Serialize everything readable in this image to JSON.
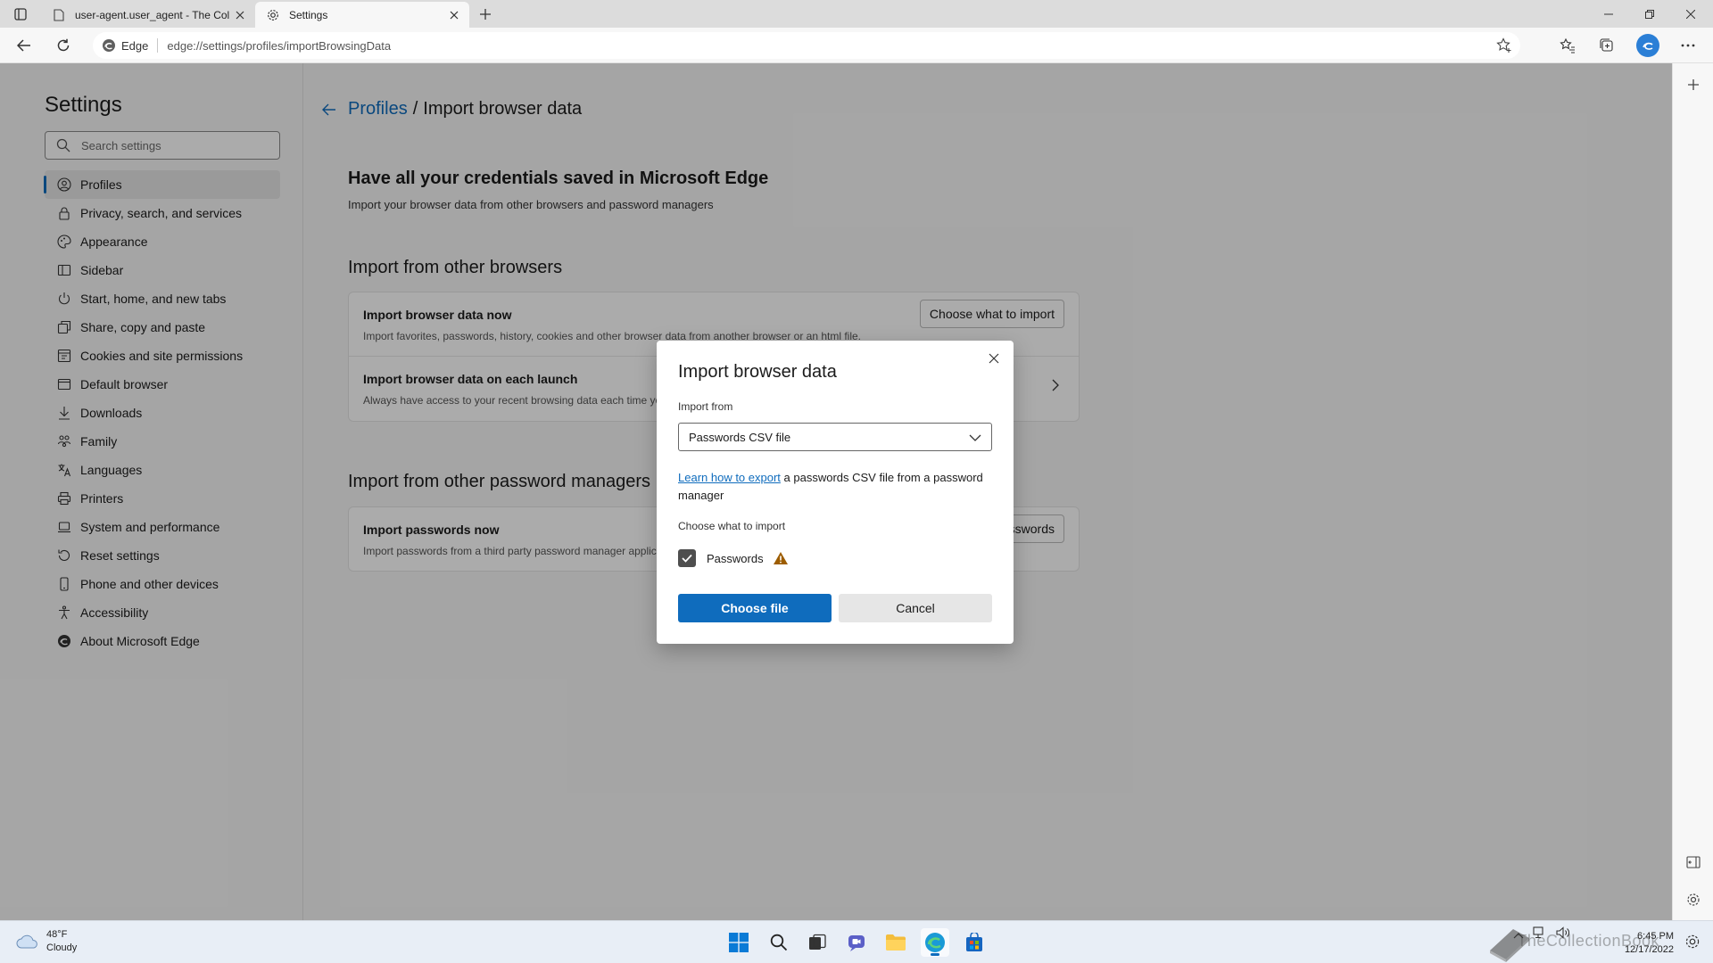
{
  "browser": {
    "tabs": [
      {
        "title": "user-agent.user_agent - The Coll",
        "active": false
      },
      {
        "title": "Settings",
        "active": true
      }
    ],
    "address": {
      "badge": "Edge",
      "url": "edge://settings/profiles/importBrowsingData"
    }
  },
  "sidebar": {
    "title": "Settings",
    "search_placeholder": "Search settings",
    "items": [
      {
        "label": "Profiles",
        "icon": "person-icon"
      },
      {
        "label": "Privacy, search, and services",
        "icon": "lock-icon"
      },
      {
        "label": "Appearance",
        "icon": "palette-icon"
      },
      {
        "label": "Sidebar",
        "icon": "sidebar-icon"
      },
      {
        "label": "Start, home, and new tabs",
        "icon": "power-icon"
      },
      {
        "label": "Share, copy and paste",
        "icon": "share-icon"
      },
      {
        "label": "Cookies and site permissions",
        "icon": "cookie-icon"
      },
      {
        "label": "Default browser",
        "icon": "browser-icon"
      },
      {
        "label": "Downloads",
        "icon": "download-icon"
      },
      {
        "label": "Family",
        "icon": "family-icon"
      },
      {
        "label": "Languages",
        "icon": "language-icon"
      },
      {
        "label": "Printers",
        "icon": "printer-icon"
      },
      {
        "label": "System and performance",
        "icon": "laptop-icon"
      },
      {
        "label": "Reset settings",
        "icon": "reset-icon"
      },
      {
        "label": "Phone and other devices",
        "icon": "phone-icon"
      },
      {
        "label": "Accessibility",
        "icon": "accessibility-icon"
      },
      {
        "label": "About Microsoft Edge",
        "icon": "edge-icon"
      }
    ]
  },
  "main": {
    "breadcrumb": {
      "parent": "Profiles",
      "separator": "/",
      "current": "Import browser data"
    },
    "heading": "Have all your credentials saved in Microsoft Edge",
    "subheading": "Import your browser data from other browsers and password managers",
    "section_browsers": {
      "title": "Import from other browsers",
      "rows": [
        {
          "title": "Import browser data now",
          "desc": "Import favorites, passwords, history, cookies and other browser data from another browser or an html file.",
          "button": "Choose what to import"
        },
        {
          "title": "Import browser data on each launch",
          "desc": "Always have access to your recent browsing data each time you"
        }
      ]
    },
    "section_passwords": {
      "title": "Import from other password managers",
      "rows": [
        {
          "title": "Import passwords now",
          "desc": "Import passwords from a third party password manager applic",
          "button": "sswords"
        }
      ]
    }
  },
  "dialog": {
    "title": "Import browser data",
    "import_from_label": "Import from",
    "import_from_value": "Passwords CSV file",
    "help_link": "Learn how to export",
    "help_text": " a passwords CSV file from a password manager",
    "choose_label": "Choose what to import",
    "checkbox_label": "Passwords",
    "checkbox_checked": true,
    "primary_button": "Choose file",
    "secondary_button": "Cancel"
  },
  "taskbar": {
    "weather_temp": "48°F",
    "weather_desc": "Cloudy",
    "time": "6:45 PM",
    "date": "12/17/2022",
    "watermark": "TheCollectionBook"
  },
  "colors": {
    "accent": "#0f6cbd",
    "warning": "#9d5d00"
  }
}
